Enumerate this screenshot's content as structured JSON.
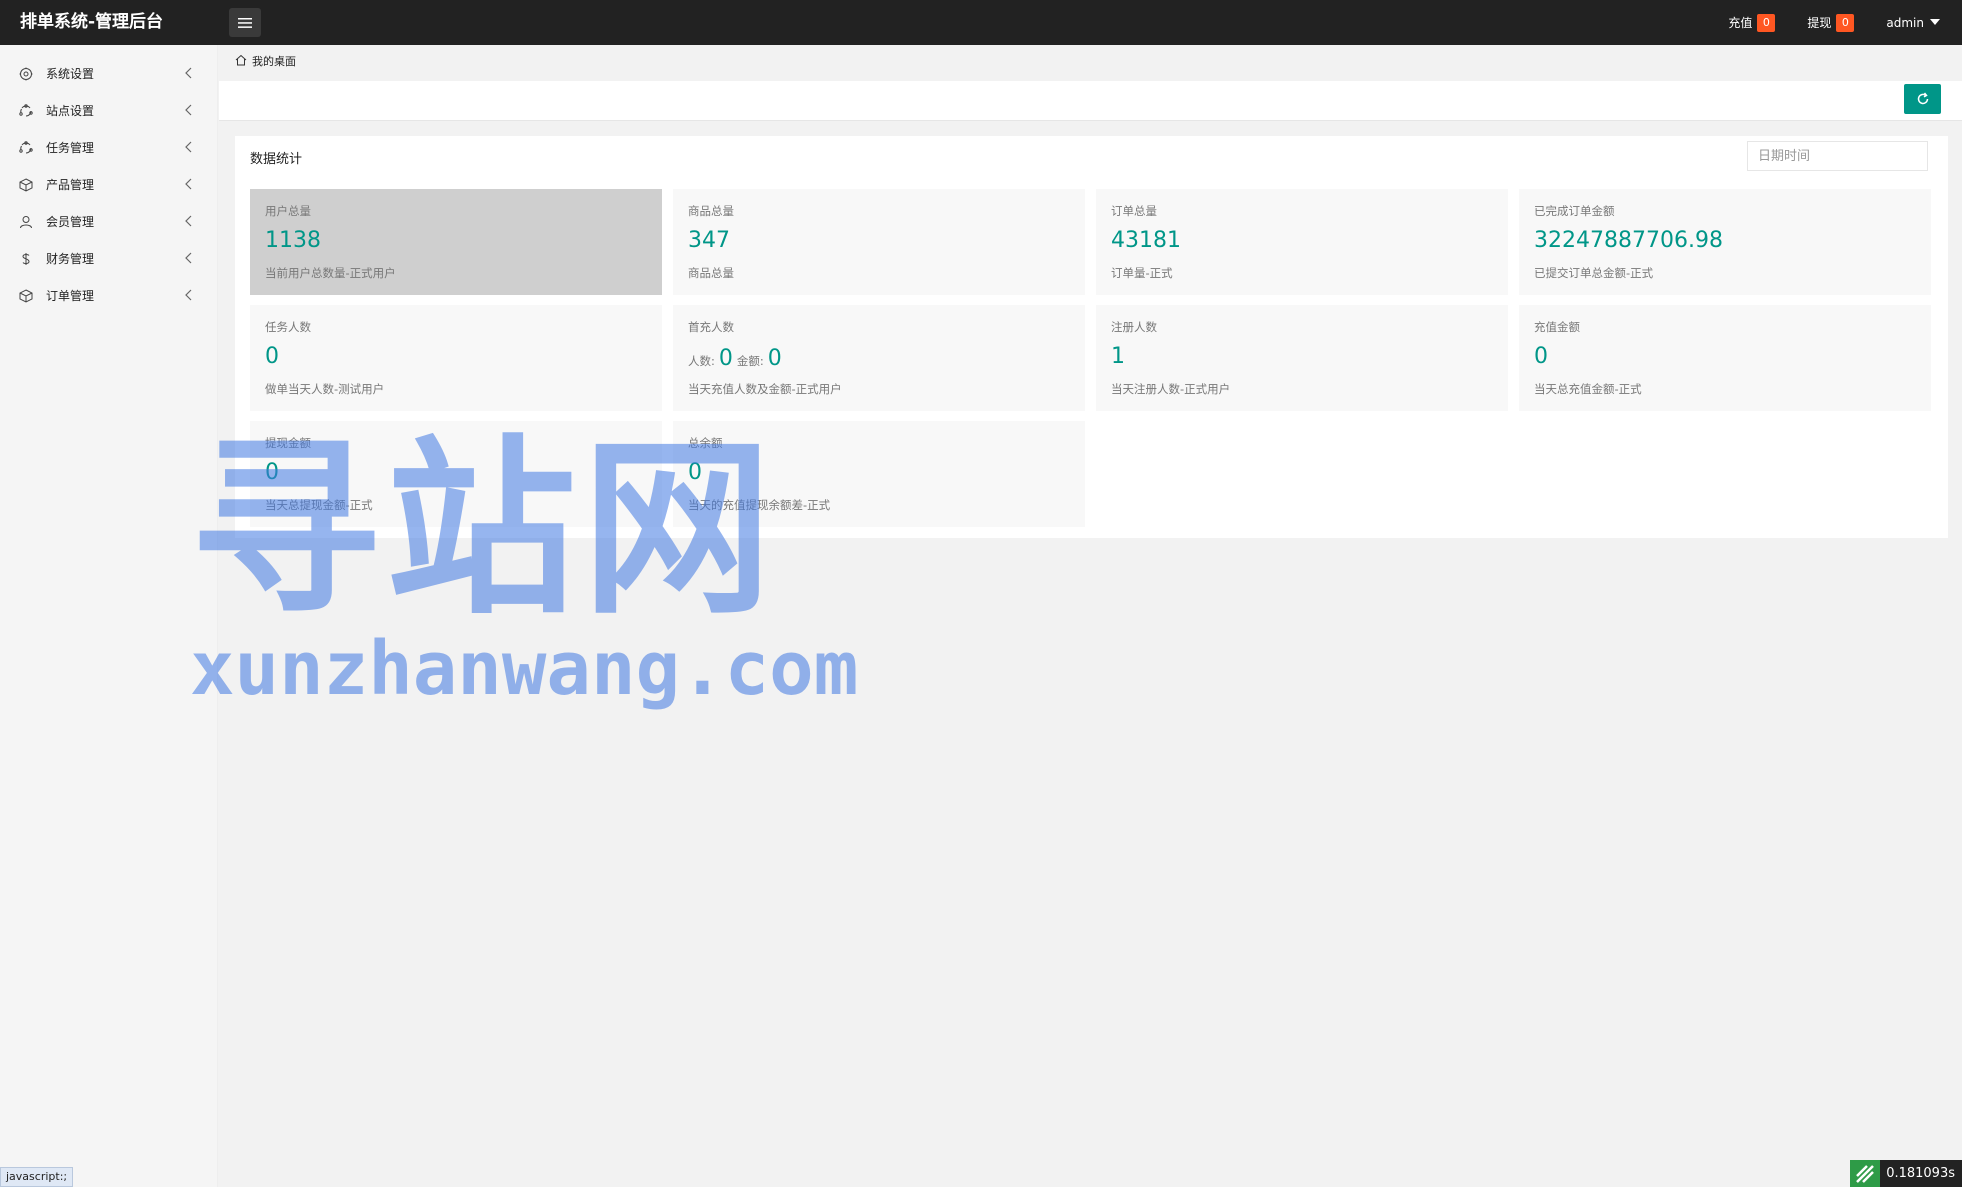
{
  "header": {
    "title": "排单系统-管理后台",
    "recharge_label": "充值",
    "recharge_count": "0",
    "withdraw_label": "提现",
    "withdraw_count": "0",
    "user": "admin"
  },
  "sidebar": {
    "items": [
      {
        "label": "系统设置",
        "icon": "gear-icon"
      },
      {
        "label": "站点设置",
        "icon": "cycle-icon"
      },
      {
        "label": "任务管理",
        "icon": "cycle-icon"
      },
      {
        "label": "产品管理",
        "icon": "box-icon"
      },
      {
        "label": "会员管理",
        "icon": "user-icon"
      },
      {
        "label": "财务管理",
        "icon": "dollar-icon"
      },
      {
        "label": "订单管理",
        "icon": "box-icon"
      }
    ]
  },
  "breadcrumb": {
    "label": "我的桌面"
  },
  "stats": {
    "title": "数据统计",
    "date_placeholder": "日期时间",
    "cards": [
      {
        "title": "用户总量",
        "value": "1138",
        "sub": "当前用户总数量-正式用户"
      },
      {
        "title": "商品总量",
        "value": "347",
        "sub": "商品总量"
      },
      {
        "title": "订单总量",
        "value": "43181",
        "sub": "订单量-正式"
      },
      {
        "title": "已完成订单金额",
        "value": "32247887706.98",
        "sub": "已提交订单总金额-正式"
      },
      {
        "title": "任务人数",
        "value": "0",
        "sub": "做单当天人数-测试用户"
      },
      {
        "title": "首充人数",
        "people_label": "人数:",
        "people_value": "0",
        "amount_label": "金额:",
        "amount_value": "0",
        "sub": "当天充值人数及金额-正式用户"
      },
      {
        "title": "注册人数",
        "value": "1",
        "sub": "当天注册人数-正式用户"
      },
      {
        "title": "充值金额",
        "value": "0",
        "sub": "当天总充值金额-正式"
      },
      {
        "title": "提现金额",
        "value": "0",
        "sub": "当天总提现金额-正式"
      },
      {
        "title": "总余额",
        "value": "0",
        "sub": "当天的充值提现余额差-正式"
      }
    ]
  },
  "watermark": {
    "cn": "寻站网",
    "en": "xunzhanwang.com"
  },
  "status": {
    "link": "javascript:;",
    "timer": "0.181093s"
  },
  "colors": {
    "accent": "#009688",
    "badge": "#ff5722",
    "topbar": "#222222"
  }
}
